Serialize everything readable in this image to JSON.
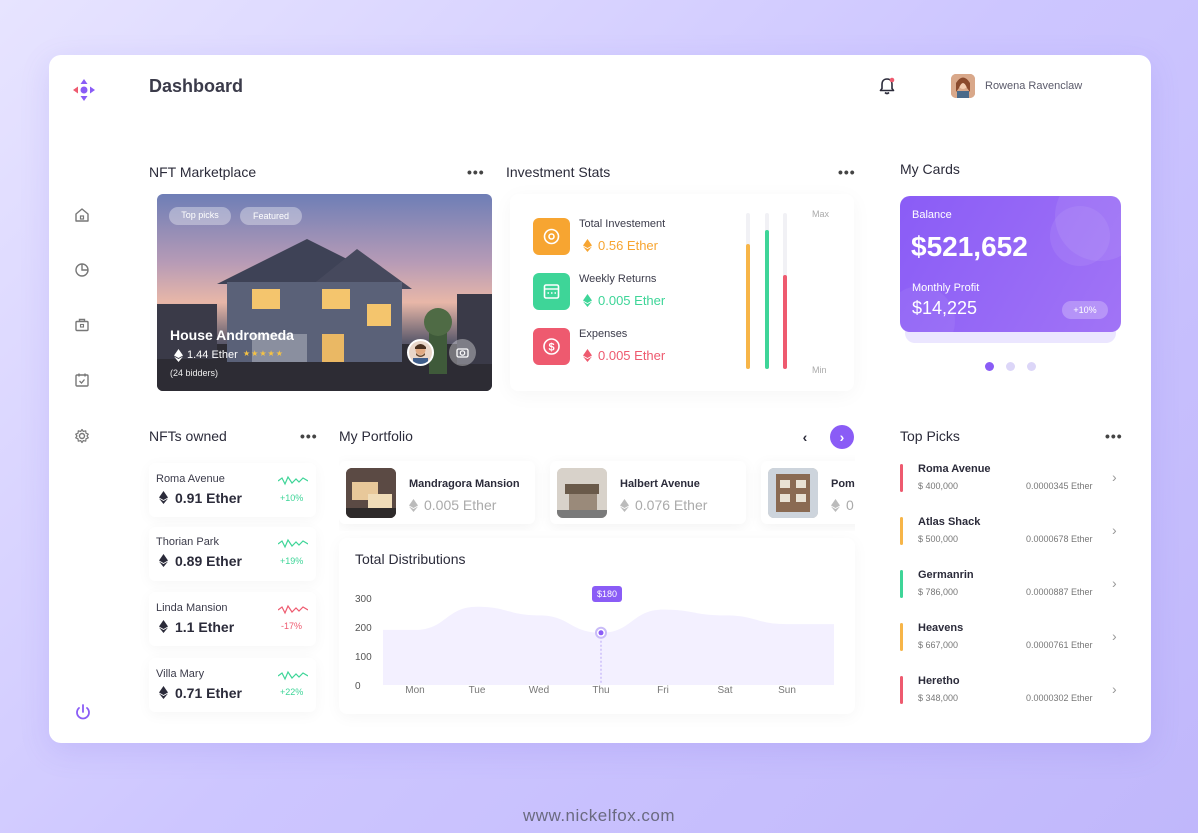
{
  "header": {
    "title": "Dashboard",
    "user_name": "Rowena Ravenclaw"
  },
  "nav": {
    "items": [
      "home-icon",
      "pie-chart-icon",
      "briefcase-icon",
      "calendar-icon",
      "gear-icon"
    ],
    "logout": "power-icon"
  },
  "marketplace": {
    "title": "NFT Marketplace",
    "menu": "•••",
    "chips": [
      "Top picks",
      "Featured"
    ],
    "name": "House Andromeda",
    "price": "1.44 Ether",
    "stars": "★★★★★",
    "bidders": "(24 bidders)"
  },
  "investment": {
    "title": "Investment Stats",
    "menu": "•••",
    "items": [
      {
        "label": "Total Investement",
        "value": "0.56 Ether",
        "color": "#f7a531",
        "icon": "target-icon"
      },
      {
        "label": "Weekly Returns",
        "value": "0.005 Ether",
        "color": "#3ed598",
        "icon": "calendar-icon"
      },
      {
        "label": "Expenses",
        "value": "0.005 Ether",
        "color": "#ee5a6f",
        "icon": "dollar-icon"
      }
    ],
    "bars": [
      {
        "color": "#f7b548",
        "level": 0.8
      },
      {
        "color": "#3ed598",
        "level": 0.89
      },
      {
        "color": "#ee5a6f",
        "level": 0.6
      }
    ],
    "max_label": "Max",
    "min_label": "Min"
  },
  "cards": {
    "title": "My Cards",
    "balance_label": "Balance",
    "balance": "$521,652",
    "profit_label": "Monthly Profit",
    "profit": "$14,225",
    "profit_badge": "+10%",
    "page_dots": 3,
    "active_dot": 0
  },
  "owned": {
    "title": "NFTs owned",
    "menu": "•••",
    "items": [
      {
        "name": "Roma Avenue",
        "value": "0.91 Ether",
        "change": "+10%",
        "trend": "up"
      },
      {
        "name": "Thorian Park",
        "value": "0.89 Ether",
        "change": "+19%",
        "trend": "up"
      },
      {
        "name": "Linda Mansion",
        "value": "1.1 Ether",
        "change": "-17%",
        "trend": "down"
      },
      {
        "name": "Villa Mary",
        "value": "0.71 Ether",
        "change": "+22%",
        "trend": "up"
      }
    ]
  },
  "portfolio": {
    "title": "My Portfolio",
    "prev": "‹",
    "next": "›",
    "items": [
      {
        "name": "Mandragora Mansion",
        "value": "0.005 Ether"
      },
      {
        "name": "Halbert Avenue",
        "value": "0.076 Ether"
      },
      {
        "name": "Pome",
        "value": "0"
      }
    ]
  },
  "distribution": {
    "title": "Total Distributions",
    "tooltip": "$180"
  },
  "chart_data": {
    "type": "area",
    "title": "Total Distributions",
    "categories": [
      "Mon",
      "Tue",
      "Wed",
      "Thu",
      "Fri",
      "Sat",
      "Sun"
    ],
    "yticks": [
      300,
      200,
      100,
      0
    ],
    "ylim": [
      0,
      300
    ],
    "values": [
      190,
      270,
      240,
      180,
      260,
      240,
      210
    ],
    "highlight": {
      "category": "Thu",
      "label": "$180"
    }
  },
  "picks": {
    "title": "Top Picks",
    "menu": "•••",
    "items": [
      {
        "name": "Roma Avenue",
        "price": "$ 400,000",
        "eth": "0.0000345 Ether",
        "color": "#ee5a6f"
      },
      {
        "name": "Atlas Shack",
        "price": "$ 500,000",
        "eth": "0.0000678 Ether",
        "color": "#f7b548"
      },
      {
        "name": "Germanrin",
        "price": "$ 786,000",
        "eth": "0.0000887 Ether",
        "color": "#3ed598"
      },
      {
        "name": "Heavens",
        "price": "$ 667,000",
        "eth": "0.0000761 Ether",
        "color": "#f7b548"
      },
      {
        "name": "Heretho",
        "price": "$ 348,000",
        "eth": "0.0000302 Ether",
        "color": "#ee5a6f"
      }
    ]
  },
  "footer": {
    "url": "www.nickelfox.com"
  }
}
